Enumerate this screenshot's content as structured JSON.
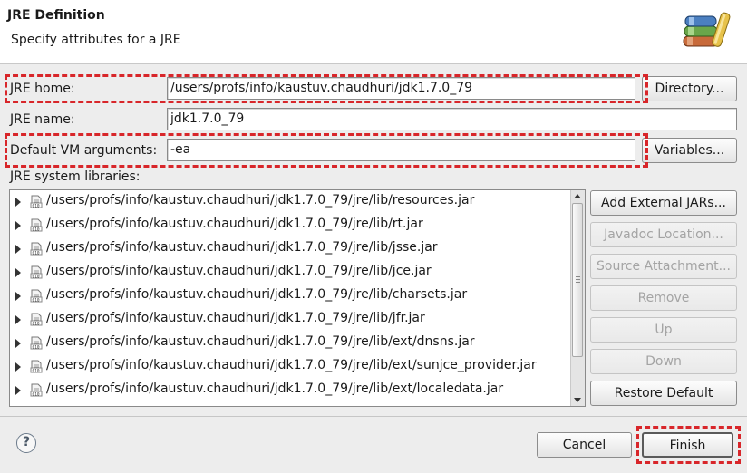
{
  "dialog": {
    "title": "JRE Definition",
    "subtitle": "Specify attributes for a JRE",
    "banner_icon": "library-books-icon"
  },
  "form": {
    "jre_home_label": "JRE home:",
    "jre_home_value": "/users/profs/info/kaustuv.chaudhuri/jdk1.7.0_79",
    "directory_button": "Directory...",
    "jre_name_label": "JRE name:",
    "jre_name_value": "jdk1.7.0_79",
    "vm_args_label": "Default VM arguments:",
    "vm_args_value": "-ea",
    "variables_button": "Variables...",
    "libraries_label": "JRE system libraries:"
  },
  "libraries": [
    "/users/profs/info/kaustuv.chaudhuri/jdk1.7.0_79/jre/lib/resources.jar",
    "/users/profs/info/kaustuv.chaudhuri/jdk1.7.0_79/jre/lib/rt.jar",
    "/users/profs/info/kaustuv.chaudhuri/jdk1.7.0_79/jre/lib/jsse.jar",
    "/users/profs/info/kaustuv.chaudhuri/jdk1.7.0_79/jre/lib/jce.jar",
    "/users/profs/info/kaustuv.chaudhuri/jdk1.7.0_79/jre/lib/charsets.jar",
    "/users/profs/info/kaustuv.chaudhuri/jdk1.7.0_79/jre/lib/jfr.jar",
    "/users/profs/info/kaustuv.chaudhuri/jdk1.7.0_79/jre/lib/ext/dnsns.jar",
    "/users/profs/info/kaustuv.chaudhuri/jdk1.7.0_79/jre/lib/ext/sunjce_provider.jar",
    "/users/profs/info/kaustuv.chaudhuri/jdk1.7.0_79/jre/lib/ext/localedata.jar"
  ],
  "library_buttons": {
    "add_external": "Add External JARs...",
    "javadoc": "Javadoc Location...",
    "source": "Source Attachment...",
    "remove": "Remove",
    "up": "Up",
    "down": "Down",
    "restore": "Restore Default"
  },
  "footer": {
    "help_glyph": "?",
    "cancel_button": "Cancel",
    "finish_button": "Finish"
  },
  "colors": {
    "highlight": "#d8262a",
    "disabled_text": "#a4a4a4"
  }
}
